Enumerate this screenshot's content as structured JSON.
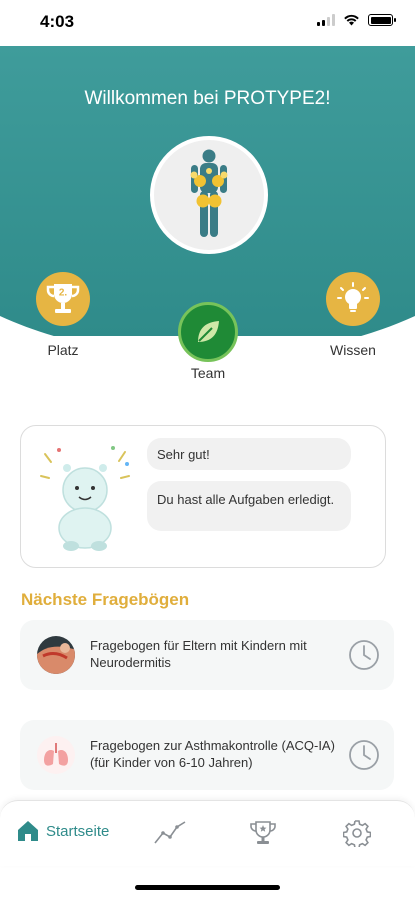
{
  "status_bar": {
    "time": "4:03"
  },
  "hero": {
    "welcome": "Willkommen bei PROTYPE2!",
    "platz_label": "Platz",
    "platz_rank": "2.",
    "team_label": "Team",
    "wissen_label": "Wissen"
  },
  "message": {
    "bubble_1": "Sehr gut!",
    "bubble_2": "Du hast alle Aufgaben erledigt."
  },
  "questionnaires": {
    "title": "Nächste Fragebögen",
    "items": [
      {
        "text": "Fragebogen für Eltern mit Kindern mit Neurodermitis",
        "icon": "skin-icon"
      },
      {
        "text": "Fragebogen zur Asthmakontrolle (ACQ-IA) (für Kinder von 6-10 Jahren)",
        "icon": "lungs-icon"
      }
    ]
  },
  "nav": {
    "home_label": "Startseite"
  },
  "colors": {
    "teal": "#2f8b8a",
    "gold": "#e6b543",
    "green": "#1f8a36",
    "section_title": "#e0ae3c"
  }
}
